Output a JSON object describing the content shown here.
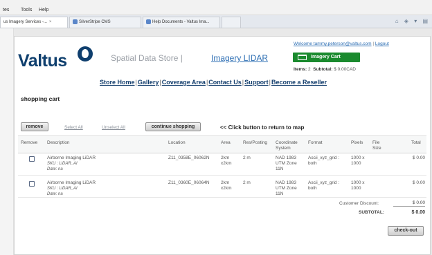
{
  "browser": {
    "menu": [
      "tes",
      "Tools",
      "Help"
    ],
    "tabs": [
      {
        "label": "us Imagery Services -...",
        "active": true
      },
      {
        "label": "SilverStripe CMS",
        "active": false
      },
      {
        "label": "Help Documents - Valtus Ima...",
        "active": false
      }
    ],
    "toolbar_icons": [
      "home-icon",
      "rss-icon",
      "chevron-down-icon",
      "print-icon"
    ]
  },
  "header": {
    "logo": "Valtus",
    "site_name": "Spatial Data Store |",
    "site_link": "Imagery LIDAR",
    "welcome_link": "Welcome tammy.peterson@valtus.com",
    "welcome_sep": "|",
    "logout": "Logout",
    "cart_button": "Imagery Cart",
    "items_label": "Items:",
    "items_count": "2",
    "subtotal_label": "Subtotal:",
    "subtotal_value": "$ 0.00CAD"
  },
  "nav": [
    {
      "label": "Store Home"
    },
    {
      "label": "Gallery"
    },
    {
      "label": "Coverage Area"
    },
    {
      "label": "Contact Us"
    },
    {
      "label": "Support"
    },
    {
      "label": "Become a Reseller"
    }
  ],
  "cart": {
    "title": "shopping cart",
    "remove_button": "remove",
    "select_all": "Select All",
    "unselect_all": "Unselect All",
    "continue_button": "continue shopping",
    "hint": "<< Click button to return to map",
    "columns": [
      "Remove",
      "Description",
      "Location",
      "Area",
      "Res/Posting",
      "Coordinate System",
      "Format",
      "Pixels",
      "File Size",
      "Total"
    ],
    "rows": [
      {
        "checked": false,
        "description": "Airborne Imaging LiDAR",
        "sku": "SKU : LiDAR_AI",
        "date": "Date: na",
        "location": "Z11_0358E_06062N",
        "area": "2km x2km",
        "res": "2 m",
        "coord": "NAD 1983 UTM Zone 11N",
        "format": "Ascii_xyz_grid : both",
        "pixels": "1000 x 1000",
        "file_size": "",
        "total": "$ 0.00"
      },
      {
        "checked": false,
        "description": "Airborne Imaging LiDAR",
        "sku": "SKU : LiDAR_AI",
        "date": "Date: na",
        "location": "Z11_0360E_06064N",
        "area": "2km x2km",
        "res": "2 m",
        "coord": "NAD 1983 UTM Zone 11N",
        "format": "Ascii_xyz_grid : both",
        "pixels": "1000 x 1000",
        "file_size": "",
        "total": "$ 0.00"
      }
    ],
    "discount_label": "Customer Discount:",
    "discount_value": "$ 0.00",
    "subtotal_label": "SUBTOTAL:",
    "subtotal_value": "$ 0.00",
    "checkout_button": "check-out"
  },
  "colors": {
    "brand_navy": "#0f3f6e",
    "cart_green": "#1a8a2e",
    "link_blue": "#2e6fb4"
  }
}
